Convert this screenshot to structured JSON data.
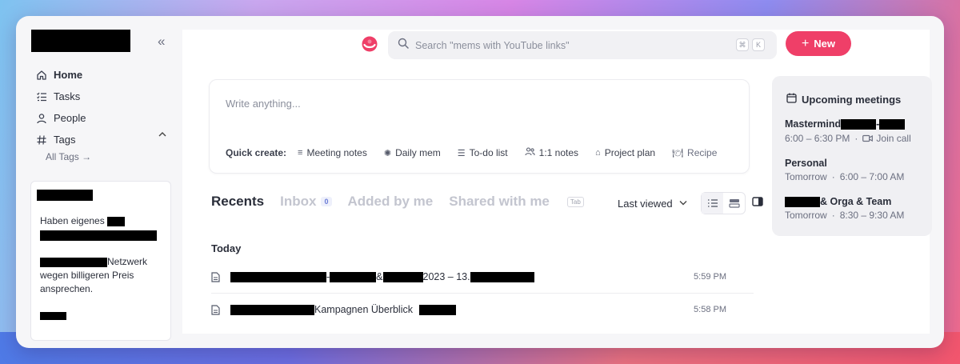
{
  "sidebar": {
    "items": [
      {
        "label": "Home",
        "icon": "home-icon"
      },
      {
        "label": "Tasks",
        "icon": "list-check-icon"
      },
      {
        "label": "People",
        "icon": "person-icon"
      },
      {
        "label": "Tags",
        "icon": "hash-icon"
      }
    ],
    "all_tags": "All Tags →",
    "note": {
      "line1": "Haben eigenes",
      "line2": "Netzwerk",
      "line3": "wegen billigeren Preis",
      "line4": "ansprechen."
    }
  },
  "search": {
    "placeholder": "Search \"mems with YouTube links\"",
    "shortcut": [
      "⌘",
      "K"
    ]
  },
  "new_button": {
    "label": "New"
  },
  "composer": {
    "placeholder": "Write anything...",
    "quick_label": "Quick create:",
    "quick_items": [
      "Meeting notes",
      "Daily mem",
      "To-do list",
      "1:1 notes",
      "Project plan",
      "Recipe"
    ]
  },
  "tabs": {
    "recents": "Recents",
    "inbox": "Inbox",
    "inbox_count": "0",
    "added_by_me": "Added by me",
    "shared_with_me": "Shared with me",
    "tab_key": "Tab",
    "sort_label": "Last viewed"
  },
  "recents": {
    "group": "Today",
    "rows": [
      {
        "sep1": "-",
        "sep2": "&",
        "text": "2023 – 13.",
        "time": "5:59 PM"
      },
      {
        "text": "Kampagnen Überblick",
        "time": "5:58 PM"
      }
    ]
  },
  "meetings": {
    "title": "Upcoming meetings",
    "items": [
      {
        "title": "Mastermind",
        "sep": "-",
        "time": "6:00 – 6:30 PM",
        "join": "Join call"
      },
      {
        "title": "Personal",
        "day": "Tomorrow",
        "time": "6:00 – 7:00 AM"
      },
      {
        "title": "& Orga & Team",
        "day": "Tomorrow",
        "time": "8:30 – 9:30 AM"
      }
    ]
  },
  "colors": {
    "accent": "#ef3f68",
    "badge": "#6a7bd6"
  }
}
